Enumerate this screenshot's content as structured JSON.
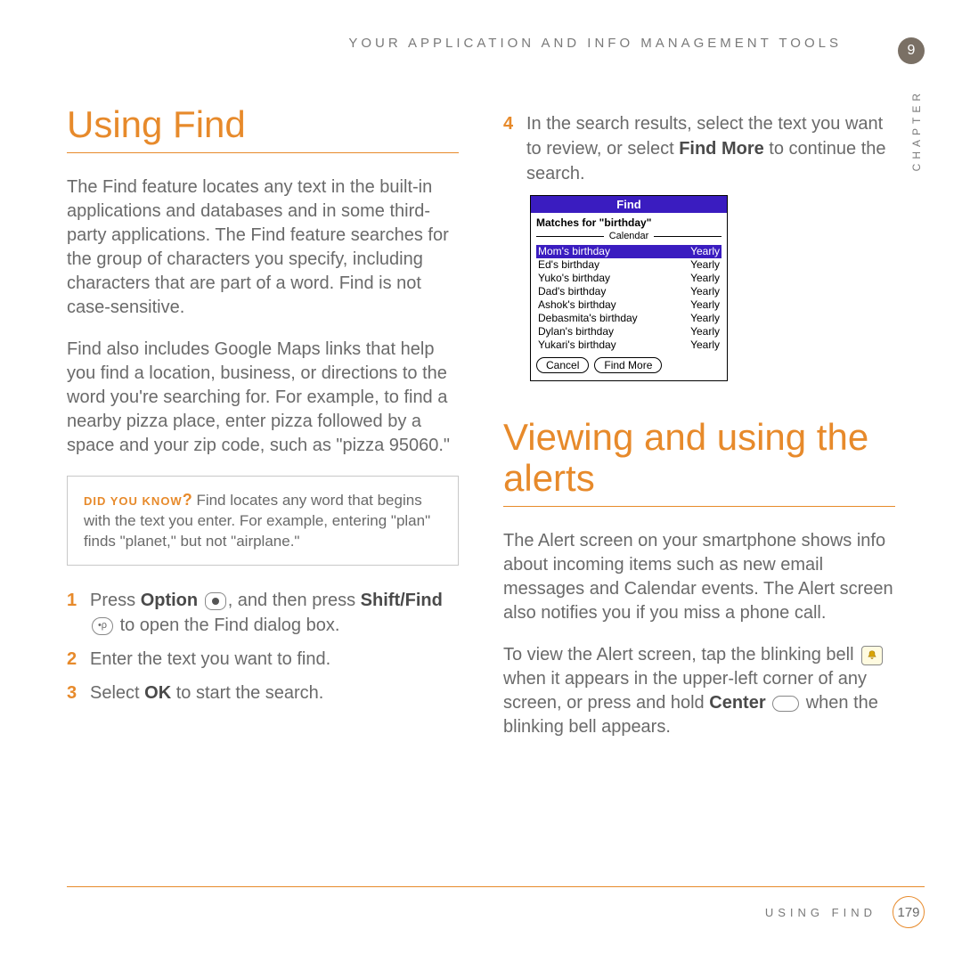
{
  "running_head": "YOUR APPLICATION AND INFO MANAGEMENT TOOLS",
  "chapter_number": "9",
  "vertical_label": "CHAPTER",
  "left": {
    "heading": "Using Find",
    "para1": "The Find feature locates any text in the built-in applications and databases and in some third-party applications. The Find feature searches for the group of characters you specify, including characters that are part of a word. Find is not case-sensitive.",
    "para2": "Find also includes Google Maps links that help you find a location, business, or directions to the word you're searching for. For example, to find a nearby pizza place, enter pizza followed by a space and your zip code, such as \"pizza 95060.\"",
    "tip_label": "DID YOU KNOW",
    "tip_q": "?",
    "tip_text": "  Find locates any word that begins with the text you enter. For example, entering \"plan\" finds \"planet,\" but not \"airplane.\"",
    "step1_pre": "Press ",
    "step1_b1": "Option",
    "step1_mid": ", and then press ",
    "step1_b2": "Shift/Find",
    "step1_post": " to open the Find dialog box.",
    "step2": "Enter the text you want to find.",
    "step3_pre": "Select ",
    "step3_b": "OK",
    "step3_post": " to start the search."
  },
  "right": {
    "step4_pre": "In the search results, select the text you want to review, or select ",
    "step4_b": "Find More",
    "step4_post": " to continue the search.",
    "dialog": {
      "title": "Find",
      "matches": "Matches for \"birthday\"",
      "divider": "Calendar",
      "rows": [
        {
          "name": "Mom's birthday",
          "freq": "Yearly",
          "selected": true
        },
        {
          "name": "Ed's birthday",
          "freq": "Yearly",
          "selected": false
        },
        {
          "name": "Yuko's birthday",
          "freq": "Yearly",
          "selected": false
        },
        {
          "name": "Dad's birthday",
          "freq": "Yearly",
          "selected": false
        },
        {
          "name": "Ashok's birthday",
          "freq": "Yearly",
          "selected": false
        },
        {
          "name": "Debasmita's birthday",
          "freq": "Yearly",
          "selected": false
        },
        {
          "name": "Dylan's birthday",
          "freq": "Yearly",
          "selected": false
        },
        {
          "name": "Yukari's birthday",
          "freq": "Yearly",
          "selected": false
        }
      ],
      "cancel": "Cancel",
      "findmore": "Find More"
    },
    "heading2": "Viewing and using the alerts",
    "para_a": "The Alert screen on your smartphone shows info about incoming items such as new email messages and Calendar events. The Alert screen also notifies you if you miss a phone call.",
    "para_b_pre": "To view the Alert screen, tap the blinking bell ",
    "para_b_mid": " when it appears in the upper-left corner of any screen, or press and hold ",
    "para_b_b": "Center",
    "para_b_post": " when the blinking bell appears."
  },
  "footer": {
    "section": "USING FIND",
    "page": "179"
  }
}
